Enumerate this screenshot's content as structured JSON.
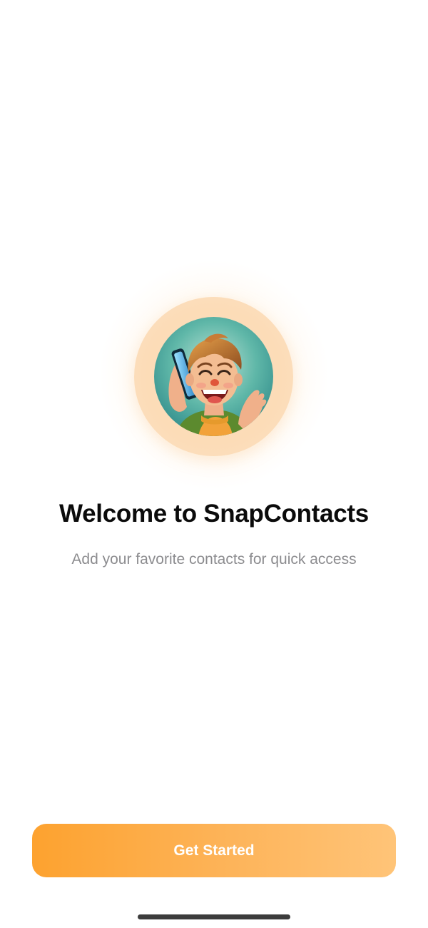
{
  "onboarding": {
    "title": "Welcome to SnapContacts",
    "subtitle": "Add your favorite contacts for quick access",
    "cta_label": "Get Started",
    "avatar_icon": "laughing-person-on-phone-illustration"
  },
  "colors": {
    "accent_start": "#fda22f",
    "accent_end": "#ffc478",
    "avatar_ring": "#fcdcb7",
    "title_text": "#0b0b0b",
    "subtitle_text": "#8c8c8f",
    "background": "#ffffff"
  }
}
